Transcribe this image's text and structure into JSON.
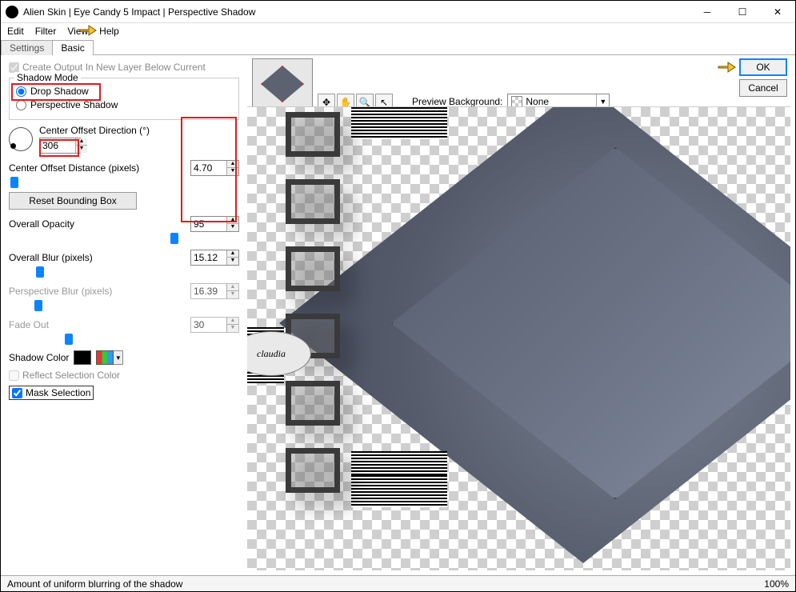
{
  "title": "Alien Skin | Eye Candy 5 Impact | Perspective Shadow",
  "menus": [
    "Edit",
    "Filter",
    "View",
    "Help"
  ],
  "tabs": {
    "settings": "Settings",
    "basic": "Basic"
  },
  "left": {
    "create_output": "Create Output In New Layer Below Current",
    "shadow_mode_legend": "Shadow Mode",
    "drop_shadow": "Drop Shadow",
    "perspective_shadow": "Perspective Shadow",
    "center_offset_dir_label": "Center Offset Direction (°)",
    "center_offset_dir_value": "306",
    "center_offset_dist_label": "Center Offset Distance (pixels)",
    "center_offset_dist_value": "4.70",
    "reset_btn": "Reset Bounding Box",
    "overall_opacity_label": "Overall Opacity",
    "overall_opacity_value": "95",
    "overall_blur_label": "Overall Blur (pixels)",
    "overall_blur_value": "15.12",
    "perspective_blur_label": "Perspective Blur (pixels)",
    "perspective_blur_value": "16.39",
    "fade_out_label": "Fade Out",
    "fade_out_value": "30",
    "shadow_color_label": "Shadow Color",
    "reflect_sel_label": "Reflect Selection Color",
    "mask_sel_label": "Mask Selection"
  },
  "right": {
    "preview_bg_label": "Preview Background:",
    "preview_bg_value": "None",
    "ok": "OK",
    "cancel": "Cancel"
  },
  "status": {
    "hint": "Amount of uniform blurring of the shadow",
    "zoom": "100%"
  },
  "watermark": "claudia"
}
